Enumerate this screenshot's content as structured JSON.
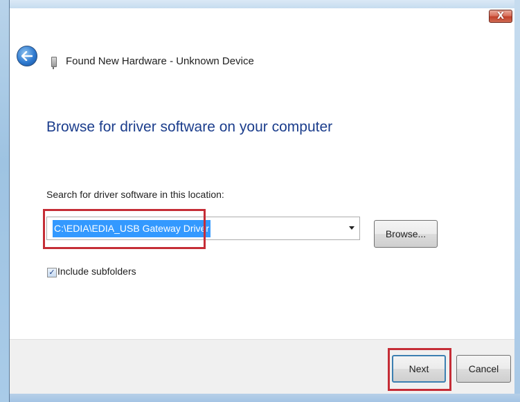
{
  "window": {
    "title": "Found New Hardware - Unknown Device",
    "close_label": "X"
  },
  "main": {
    "heading": "Browse for driver software on your computer",
    "search_label": "Search for driver software in this location:",
    "path_value": "C:\\EDIA\\EDIA_USB Gateway Driver",
    "browse_label": "Browse...",
    "include_subfolders_label": "Include subfolders",
    "include_subfolders_checked": true
  },
  "footer": {
    "next_label": "Next",
    "cancel_label": "Cancel"
  },
  "colors": {
    "heading": "#1b3d8c",
    "highlight_annotation": "#c52d36",
    "selection": "#3399ff",
    "footer_bg": "#f0f0f0"
  },
  "icons": {
    "back": "back-arrow-icon",
    "device": "usb-device-icon",
    "close": "close-icon",
    "dropdown": "chevron-down-icon",
    "check": "checkmark-icon"
  }
}
